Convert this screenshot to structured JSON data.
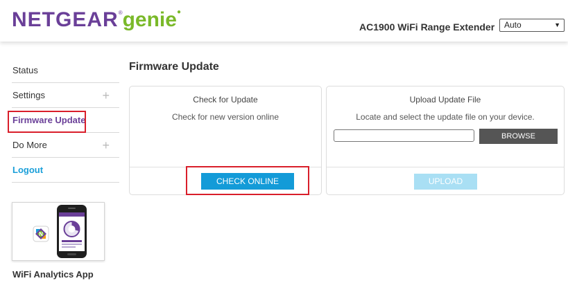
{
  "header": {
    "logo_brand": "NETGEAR",
    "logo_reg": "®",
    "logo_product": "genie",
    "device_name": "AC1900 WiFi Range Extender",
    "language_selected": "Auto"
  },
  "sidebar": {
    "items": [
      {
        "label": "Status"
      },
      {
        "label": "Settings",
        "expand": "+"
      },
      {
        "label": "Firmware Update"
      },
      {
        "label": "Do More",
        "expand": "+"
      },
      {
        "label": "Logout"
      }
    ],
    "app_label": "WiFi Analytics App"
  },
  "main": {
    "title": "Firmware Update",
    "check_panel": {
      "heading": "Check for Update",
      "subtext": "Check for new version online",
      "button": "CHECK ONLINE"
    },
    "upload_panel": {
      "heading": "Upload Update File",
      "subtext": "Locate and select the update file on your device.",
      "file_value": "",
      "browse_button": "BROWSE",
      "upload_button": "UPLOAD"
    }
  },
  "colors": {
    "brand_purple": "#6a3f98",
    "brand_green": "#7ab929",
    "accent_blue": "#139bd8",
    "highlight_red": "#d91e2a"
  }
}
